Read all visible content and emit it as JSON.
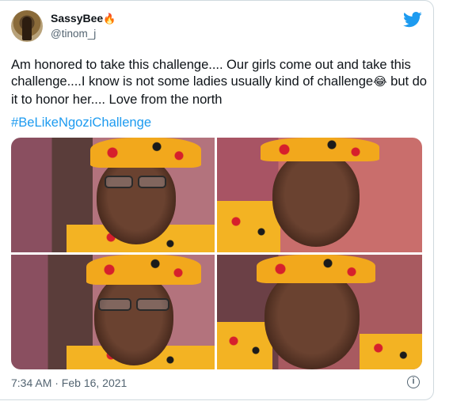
{
  "tweet": {
    "author": {
      "display_name": "SassyBee",
      "name_emoji": "🔥",
      "handle": "@tinom_j",
      "avatar_icon": "user-avatar"
    },
    "brand_icon": "twitter-bird-icon",
    "brand_color": "#1d9bf0",
    "text_part1": "Am honored to take this challenge.... Our girls come out and take this challenge....I know is not some ladies usually kind of challenge",
    "text_emoji": "😂",
    "text_part2": " but do it to honor her.... Love from the north",
    "hashtag": "#BeLikeNgoziChallenge",
    "photos": [
      "selfie-1",
      "selfie-2",
      "selfie-3",
      "selfie-4"
    ],
    "timestamp": "7:34 AM · Feb 16, 2021",
    "info_icon": "info-icon"
  }
}
